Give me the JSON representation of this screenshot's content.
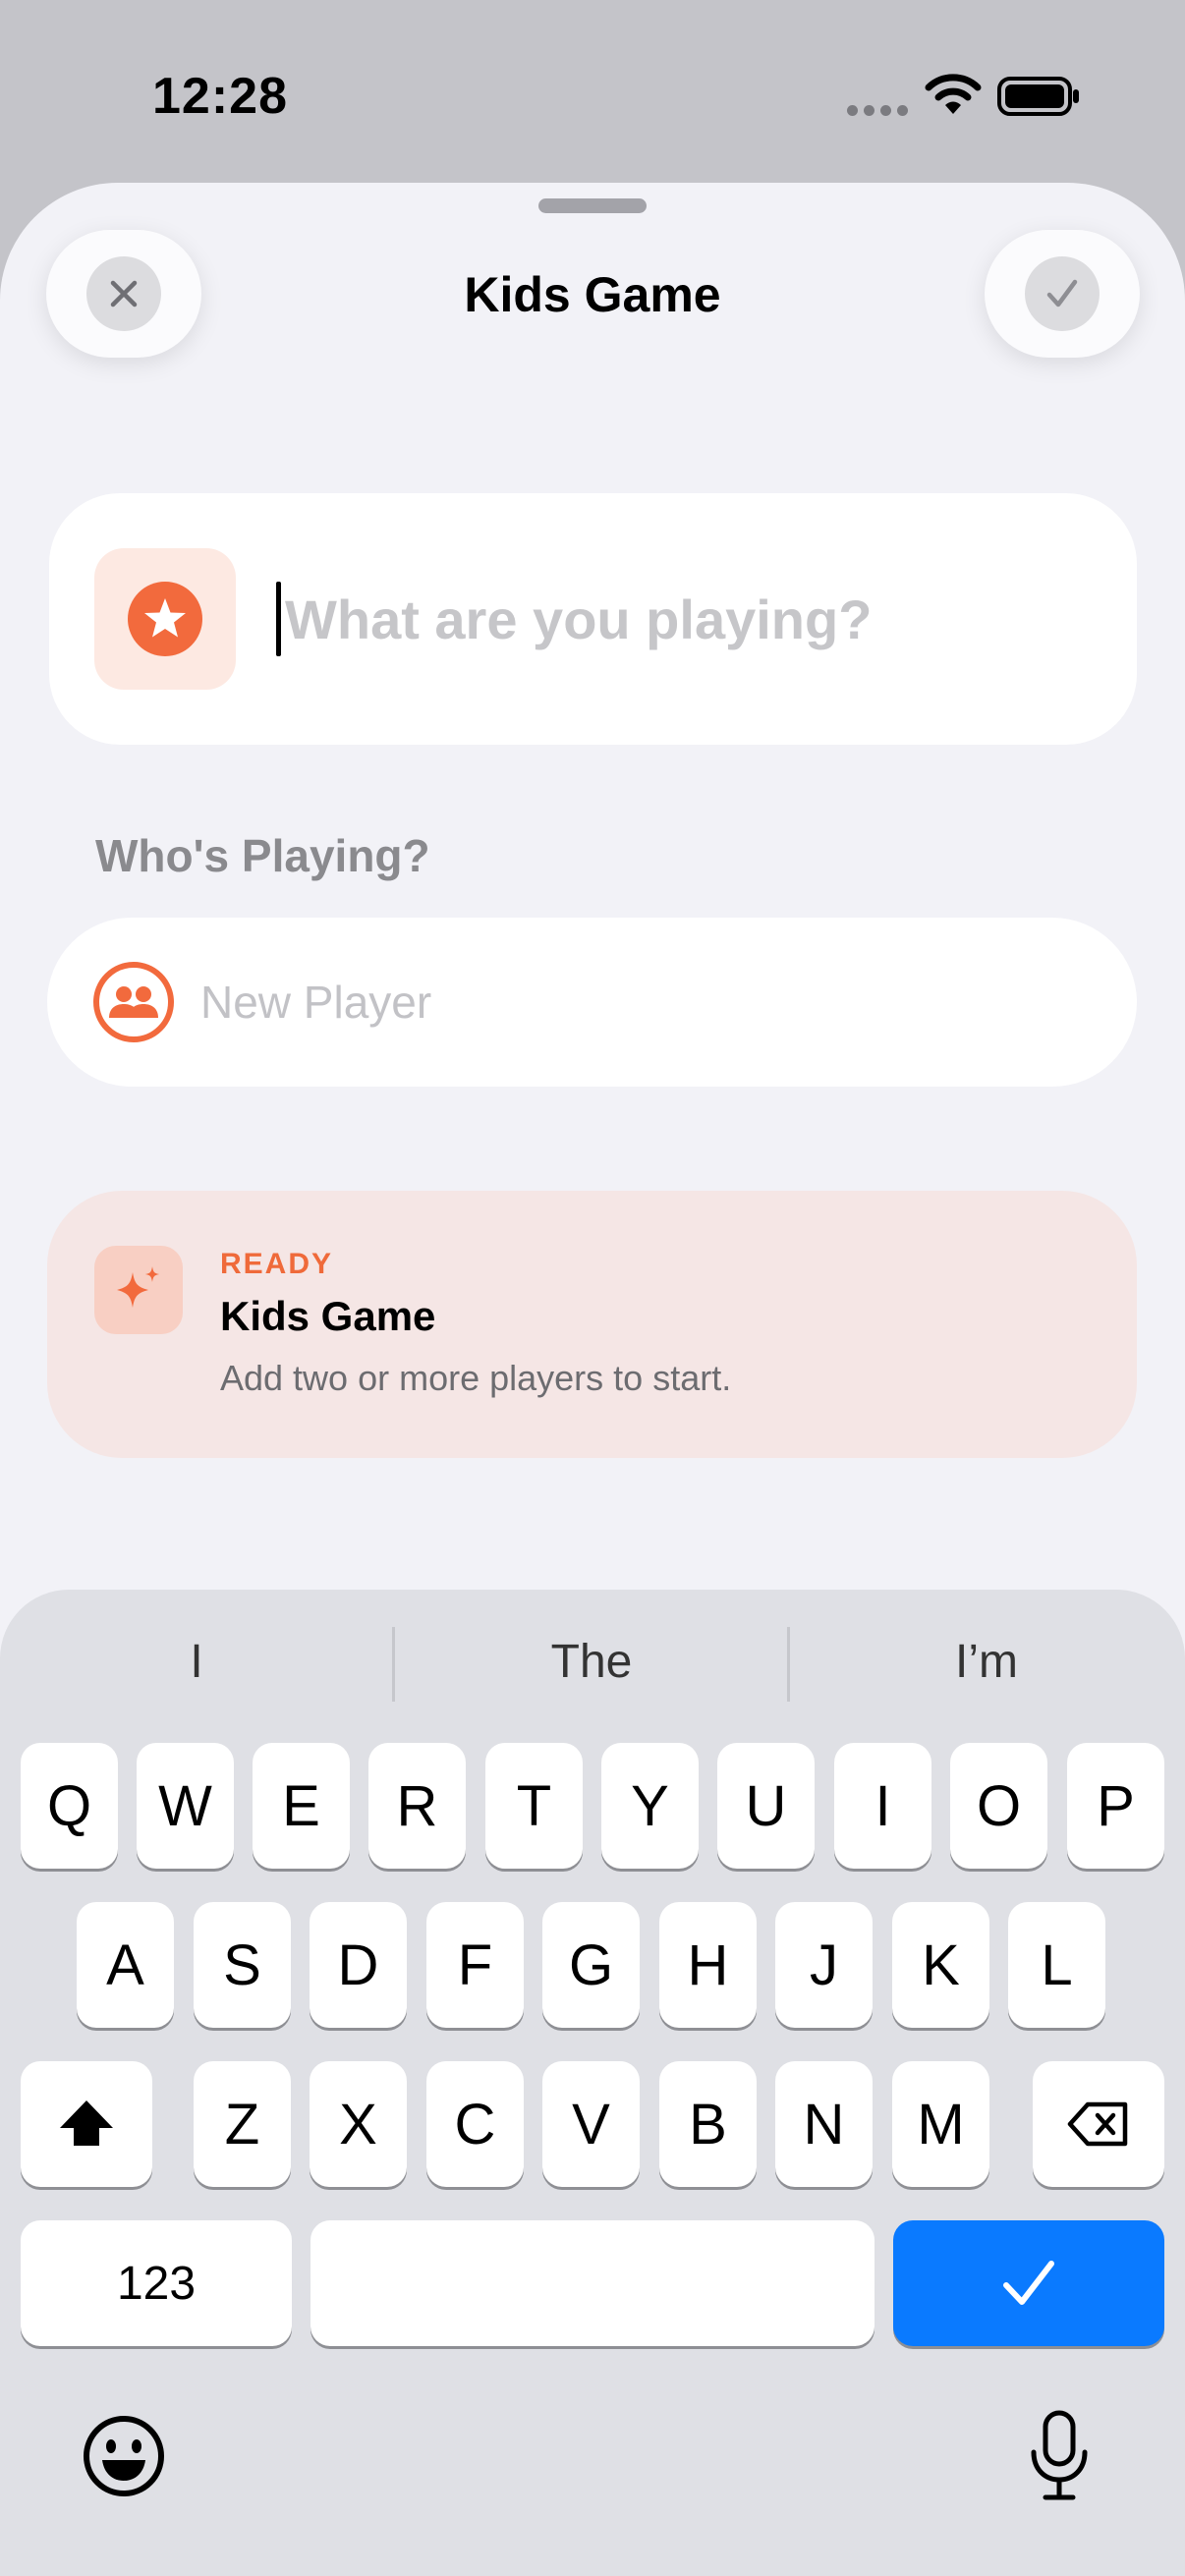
{
  "status_bar": {
    "time": "12:28"
  },
  "sheet": {
    "title": "Kids Game",
    "close_icon": "xmark-icon",
    "done_icon": "checkmark-icon"
  },
  "game_name": {
    "icon": "star-circle-icon",
    "placeholder": "What are you playing?",
    "value": ""
  },
  "players": {
    "section_label": "Who's Playing?",
    "icon": "people-icon",
    "placeholder": "New Player",
    "value": ""
  },
  "ready_card": {
    "icon": "sparkles-icon",
    "kicker": "READY",
    "title": "Kids Game",
    "subtitle": "Add two or more players to start."
  },
  "keyboard": {
    "suggestions": [
      "I",
      "The",
      "I’m"
    ],
    "row1": [
      "Q",
      "W",
      "E",
      "R",
      "T",
      "Y",
      "U",
      "I",
      "O",
      "P"
    ],
    "row2": [
      "A",
      "S",
      "D",
      "F",
      "G",
      "H",
      "J",
      "K",
      "L"
    ],
    "row3": [
      "Z",
      "X",
      "C",
      "V",
      "B",
      "N",
      "M"
    ],
    "numbers_key": "123",
    "space_key": "",
    "return_icon": "checkmark-icon",
    "emoji_icon": "emoji-icon",
    "mic_icon": "microphone-icon"
  },
  "colors": {
    "accent": "#f26a3d",
    "return_key": "#0a7aff",
    "sheet_background": "#f2f2f7"
  }
}
